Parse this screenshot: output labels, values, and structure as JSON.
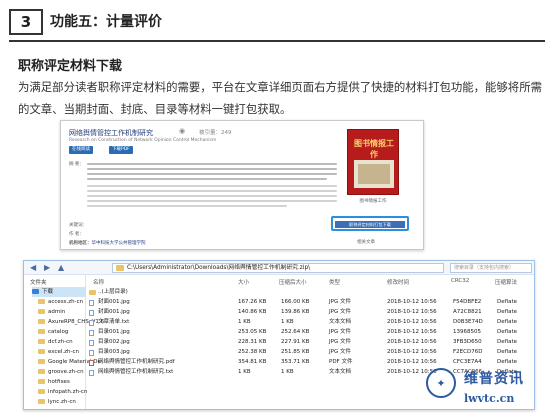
{
  "header": {
    "section_number": "3",
    "section_title": "功能五：计量评价"
  },
  "section": {
    "heading": "职称评定材料下载",
    "paragraph": "为满足部分读者职称评定材料的需要，平台在文章详细页面右方提供了快捷的材料打包功能，能够将所需的文章、当期封面、封底、目录等材料一键打包获取。"
  },
  "article_page": {
    "title": "网络舆情管控工作机制研究",
    "views": "被引量：249",
    "subtitle": "Research on Construction of Network Opinion Control Mechanism",
    "buttons": [
      "在线阅读",
      "下载PDF"
    ],
    "abstract_label": "摘 要：",
    "keywords_label": "关键词：",
    "keywords_label2": "作 者：",
    "org_label": "机构地区：",
    "org_value": "华中科技大学公共管理学院",
    "journal_title": "图书情报工作",
    "cover_label": "图书情报工作",
    "package_button": "职称评定材料打包下载",
    "related_label": "相关文章"
  },
  "explorer": {
    "address": "C:\\Users\\Administrator\\Downloads\\网络舆情管控工作机制研究.zip\\",
    "search_placeholder": "搜索目录（支持包内搜索）",
    "sidebar_header": "文件夹",
    "sidebar_items": [
      "下载",
      "access.zh-cn",
      "admin",
      "AxureRP8_CHS_V1.6",
      "catalog",
      "dcf.zh-cn",
      "excel.zh-cn",
      "Google Material De",
      "groove.zh-cn",
      "hotfixes",
      "infopath.zh-cn",
      "lync.zh-cn"
    ],
    "columns": [
      "名称",
      "大小",
      "压缩后大小",
      "类型",
      "修改时间",
      "CRC32",
      "压缩算法"
    ],
    "files": [
      {
        "name": "..(上层目录)",
        "size": "",
        "packed": "",
        "type": "",
        "modified": "",
        "crc": "",
        "method": ""
      },
      {
        "name": "封面001.jpg",
        "size": "167.26 KB",
        "packed": "166.00 KB",
        "type": "JPG 文件",
        "modified": "2018-10-12 10:56",
        "crc": "F54DBFE2",
        "method": "Deflate"
      },
      {
        "name": "封面001.jpg",
        "size": "140.86 KB",
        "packed": "139.86 KB",
        "type": "JPG 文件",
        "modified": "2018-10-12 10:56",
        "crc": "A72C8821",
        "method": "Deflate"
      },
      {
        "name": "文章清单.txt",
        "size": "1 KB",
        "packed": "1 KB",
        "type": "文本文档",
        "modified": "2018-10-12 10:56",
        "crc": "D0B3E74D",
        "method": "Deflate"
      },
      {
        "name": "目录001.jpg",
        "size": "253.05 KB",
        "packed": "252.64 KB",
        "type": "JPG 文件",
        "modified": "2018-10-12 10:56",
        "crc": "13968505",
        "method": "Deflate"
      },
      {
        "name": "目录002.jpg",
        "size": "228.31 KB",
        "packed": "227.91 KB",
        "type": "JPG 文件",
        "modified": "2018-10-12 10:56",
        "crc": "3FB3D650",
        "method": "Deflate"
      },
      {
        "name": "目录003.jpg",
        "size": "252.38 KB",
        "packed": "251.85 KB",
        "type": "JPG 文件",
        "modified": "2018-10-12 10:56",
        "crc": "F2ECD76D",
        "method": "Deflate"
      },
      {
        "name": "网络舆情管控工作机制研究.pdf",
        "size": "354.81 KB",
        "packed": "353.71 KB",
        "type": "PDF 文件",
        "modified": "2018-10-12 10:56",
        "crc": "CFC3E7A4",
        "method": "Deflate"
      },
      {
        "name": "网络舆情管控工作机制研究.txt",
        "size": "1 KB",
        "packed": "1 KB",
        "type": "文本文档",
        "modified": "2018-10-12 10:56",
        "crc": "CC7AC066",
        "method": "Deflate"
      }
    ]
  },
  "watermark": {
    "cn": "维普资讯",
    "en": "lwvtc.cn"
  }
}
